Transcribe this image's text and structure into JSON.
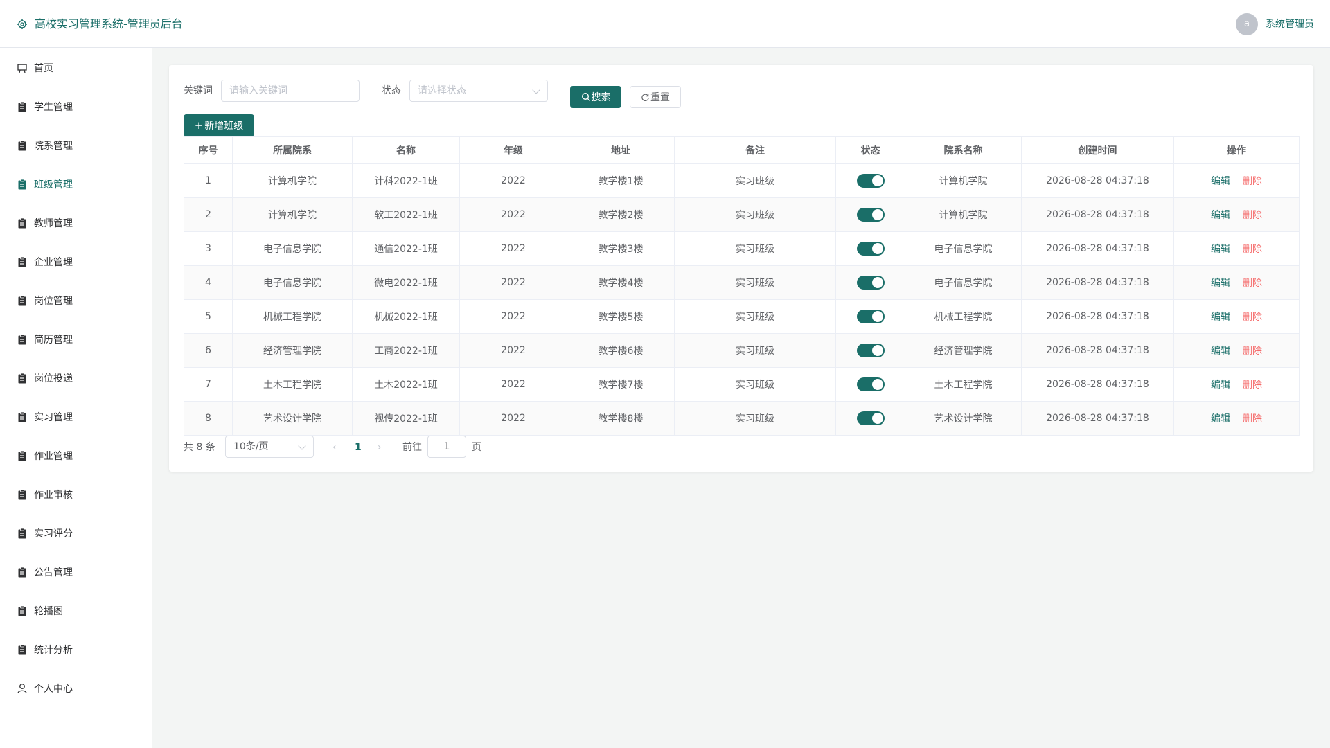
{
  "header": {
    "title": "高校实习管理系统-管理员后台",
    "avatar_letter": "a",
    "username": "系统管理员"
  },
  "sidebar": {
    "items": [
      {
        "label": "首页",
        "icon": "home-icon"
      },
      {
        "label": "学生管理",
        "icon": "clipboard-icon"
      },
      {
        "label": "院系管理",
        "icon": "clipboard-icon"
      },
      {
        "label": "班级管理",
        "icon": "clipboard-icon",
        "active": true
      },
      {
        "label": "教师管理",
        "icon": "clipboard-icon"
      },
      {
        "label": "企业管理",
        "icon": "clipboard-icon"
      },
      {
        "label": "岗位管理",
        "icon": "clipboard-icon"
      },
      {
        "label": "简历管理",
        "icon": "clipboard-icon"
      },
      {
        "label": "岗位投递",
        "icon": "clipboard-icon"
      },
      {
        "label": "实习管理",
        "icon": "clipboard-icon"
      },
      {
        "label": "作业管理",
        "icon": "clipboard-icon"
      },
      {
        "label": "作业审核",
        "icon": "clipboard-icon"
      },
      {
        "label": "实习评分",
        "icon": "clipboard-icon"
      },
      {
        "label": "公告管理",
        "icon": "clipboard-icon"
      },
      {
        "label": "轮播图",
        "icon": "clipboard-icon"
      },
      {
        "label": "统计分析",
        "icon": "clipboard-icon"
      },
      {
        "label": "个人中心",
        "icon": "user-icon"
      }
    ]
  },
  "search": {
    "keyword_label": "关键词",
    "keyword_placeholder": "请输入关键词",
    "status_label": "状态",
    "status_placeholder": "请选择状态",
    "search_button": "搜索",
    "reset_button": "重置",
    "add_button": "新增班级"
  },
  "table": {
    "columns": [
      "序号",
      "所属院系",
      "名称",
      "年级",
      "地址",
      "备注",
      "状态",
      "院系名称",
      "创建时间",
      "操作"
    ],
    "rows": [
      {
        "no": "1",
        "dept": "计算机学院",
        "name": "计科2022-1班",
        "grade": "2022",
        "address": "教学楼1楼",
        "remark": "实习班级",
        "status": true,
        "dept_name": "计算机学院",
        "created": "2026-08-28 04:37:18"
      },
      {
        "no": "2",
        "dept": "计算机学院",
        "name": "软工2022-1班",
        "grade": "2022",
        "address": "教学楼2楼",
        "remark": "实习班级",
        "status": true,
        "dept_name": "计算机学院",
        "created": "2026-08-28 04:37:18"
      },
      {
        "no": "3",
        "dept": "电子信息学院",
        "name": "通信2022-1班",
        "grade": "2022",
        "address": "教学楼3楼",
        "remark": "实习班级",
        "status": true,
        "dept_name": "电子信息学院",
        "created": "2026-08-28 04:37:18"
      },
      {
        "no": "4",
        "dept": "电子信息学院",
        "name": "微电2022-1班",
        "grade": "2022",
        "address": "教学楼4楼",
        "remark": "实习班级",
        "status": true,
        "dept_name": "电子信息学院",
        "created": "2026-08-28 04:37:18"
      },
      {
        "no": "5",
        "dept": "机械工程学院",
        "name": "机械2022-1班",
        "grade": "2022",
        "address": "教学楼5楼",
        "remark": "实习班级",
        "status": true,
        "dept_name": "机械工程学院",
        "created": "2026-08-28 04:37:18"
      },
      {
        "no": "6",
        "dept": "经济管理学院",
        "name": "工商2022-1班",
        "grade": "2022",
        "address": "教学楼6楼",
        "remark": "实习班级",
        "status": true,
        "dept_name": "经济管理学院",
        "created": "2026-08-28 04:37:18"
      },
      {
        "no": "7",
        "dept": "土木工程学院",
        "name": "土木2022-1班",
        "grade": "2022",
        "address": "教学楼7楼",
        "remark": "实习班级",
        "status": true,
        "dept_name": "土木工程学院",
        "created": "2026-08-28 04:37:18"
      },
      {
        "no": "8",
        "dept": "艺术设计学院",
        "name": "视传2022-1班",
        "grade": "2022",
        "address": "教学楼8楼",
        "remark": "实习班级",
        "status": true,
        "dept_name": "艺术设计学院",
        "created": "2026-08-28 04:37:18"
      }
    ],
    "edit_label": "编辑",
    "delete_label": "删除"
  },
  "pagination": {
    "total": "共 8 条",
    "page_size": "10条/页",
    "current_page": "1",
    "goto_label": "前往",
    "goto_value": "1",
    "page_suffix": "页"
  },
  "colors": {
    "accent": "#1a6e68",
    "danger": "#f56c6c"
  }
}
